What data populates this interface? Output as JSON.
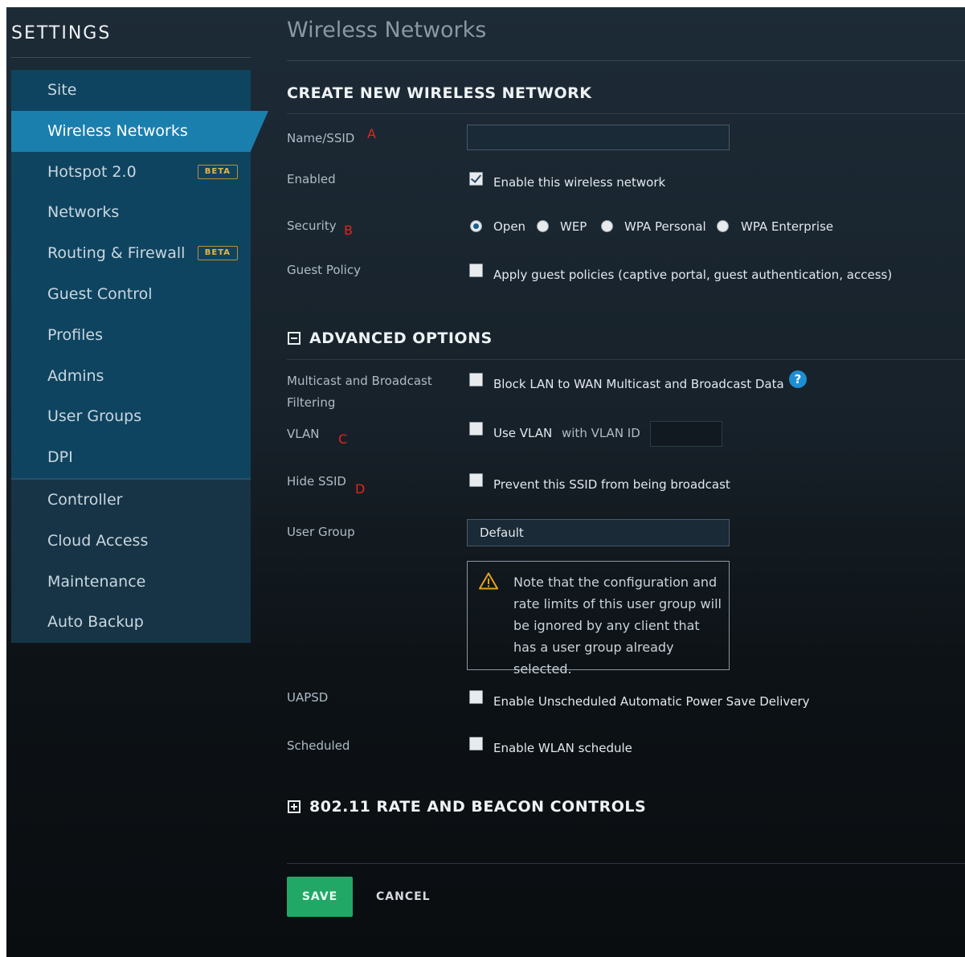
{
  "sidebar": {
    "title": "SETTINGS",
    "items": [
      {
        "label": "Site"
      },
      {
        "label": "Wireless Networks"
      },
      {
        "label": "Hotspot 2.0",
        "badge": "BETA"
      },
      {
        "label": "Networks"
      },
      {
        "label": "Routing & Firewall",
        "badge": "BETA"
      },
      {
        "label": "Guest Control"
      },
      {
        "label": "Profiles"
      },
      {
        "label": "Admins"
      },
      {
        "label": "User Groups"
      },
      {
        "label": "DPI"
      },
      {
        "label": "Controller"
      },
      {
        "label": "Cloud Access"
      },
      {
        "label": "Maintenance"
      },
      {
        "label": "Auto Backup"
      }
    ],
    "active_item": "Wireless Networks"
  },
  "page": {
    "title": "Wireless Networks"
  },
  "create": {
    "heading": "CREATE NEW WIRELESS NETWORK",
    "name_label": "Name/SSID",
    "name_marker": "A",
    "name_value": "",
    "enabled_label": "Enabled",
    "enabled_text": "Enable this wireless network",
    "enabled_checked": true,
    "security_label": "Security",
    "security_marker": "B",
    "security_options": [
      "Open",
      "WEP",
      "WPA Personal",
      "WPA Enterprise"
    ],
    "security_selected": "Open",
    "guest_label": "Guest Policy",
    "guest_text": "Apply guest policies (captive portal, guest authentication, access)"
  },
  "advanced": {
    "heading": "ADVANCED OPTIONS",
    "multicast_label_1": "Multicast and Broadcast",
    "multicast_label_2": "Filtering",
    "multicast_text": "Block LAN to WAN Multicast and Broadcast Data",
    "help_glyph": "?",
    "vlan_label": "VLAN",
    "vlan_marker": "C",
    "vlan_text": "Use VLAN",
    "vlan_id_text": "with VLAN ID",
    "vlan_id_value": "",
    "hide_label": "Hide SSID",
    "hide_marker": "D",
    "hide_text": "Prevent this SSID from being broadcast",
    "user_group_label": "User Group",
    "user_group_value": "Default",
    "note": "Note that the configuration and rate limits of this user group will be ignored by any client that has a user group already selected.",
    "uapsd_label": "UAPSD",
    "uapsd_text": "Enable Unscheduled Automatic Power Save Delivery",
    "scheduled_label": "Scheduled",
    "scheduled_text": "Enable WLAN schedule"
  },
  "rate": {
    "heading": "802.11 RATE AND BEACON CONTROLS"
  },
  "actions": {
    "save_label": "SAVE",
    "cancel_label": "CANCEL"
  },
  "colors": {
    "accent": "#1b7fae",
    "save": "#22a866",
    "marker": "#e0261c",
    "help": "#1e8ed3"
  }
}
